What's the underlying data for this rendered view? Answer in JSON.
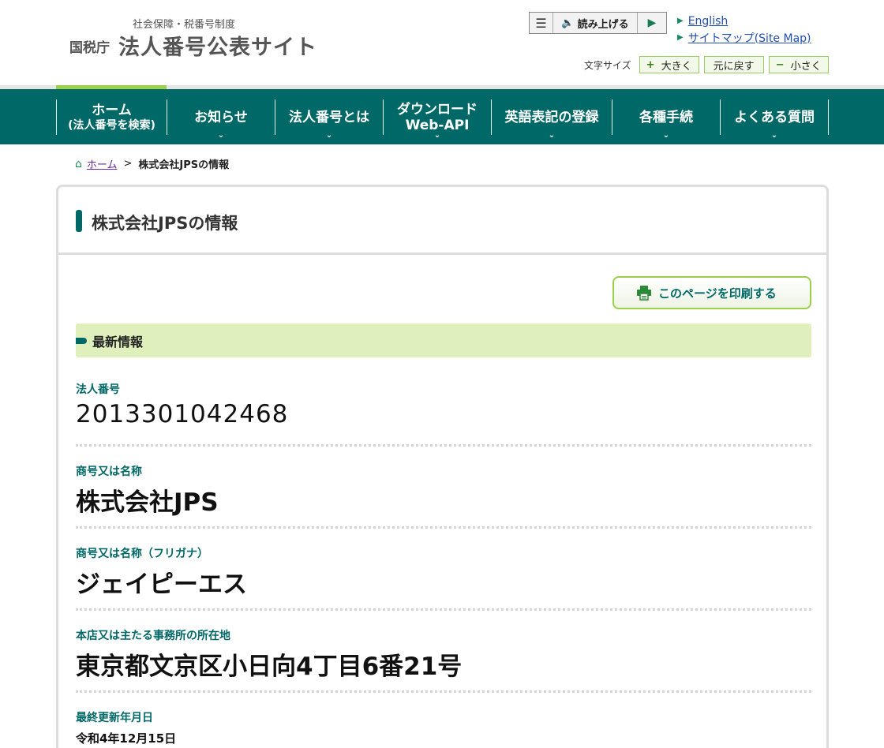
{
  "header": {
    "logo_sub": "社会保障・税番号制度",
    "logo_agency": "国税庁",
    "logo_site": "法人番号公表サイト",
    "read_aloud": "読み上げる",
    "english_link": "English",
    "sitemap_link": "サイトマップ(Site Map)",
    "fontsize_label": "文字サイズ",
    "font_larger": "大きく",
    "font_reset": "元に戻す",
    "font_smaller": "小さく"
  },
  "nav": {
    "items": [
      {
        "label": "ホーム",
        "sub": "(法人番号を検索)"
      },
      {
        "label": "お知らせ",
        "sub": ""
      },
      {
        "label": "法人番号とは",
        "sub": ""
      },
      {
        "label": "ダウンロード",
        "sub": "Web-API"
      },
      {
        "label": "英語表記の登録",
        "sub": ""
      },
      {
        "label": "各種手続",
        "sub": ""
      },
      {
        "label": "よくある質問",
        "sub": ""
      }
    ]
  },
  "breadcrumb": {
    "home": "ホーム",
    "separator": ">",
    "current": "株式会社JPSの情報"
  },
  "panel": {
    "title": "株式会社JPSの情報",
    "print_button": "このページを印刷する",
    "section_title": "最新情報",
    "fields": [
      {
        "label": "法人番号",
        "value": "2013301042468"
      },
      {
        "label": "商号又は名称",
        "value": "株式会社JPS"
      },
      {
        "label": "商号又は名称（フリガナ）",
        "value": "ジェイピーエス"
      },
      {
        "label": "本店又は主たる事務所の所在地",
        "value": "東京都文京区小日向4丁目6番21号"
      },
      {
        "label": "最終更新年月日",
        "value": "令和4年12月15日"
      }
    ]
  },
  "colors": {
    "nav_bg": "#006866",
    "accent_green": "#9bd04a",
    "section_bg": "#dff0bd",
    "link_blue": "#1f4db5"
  }
}
